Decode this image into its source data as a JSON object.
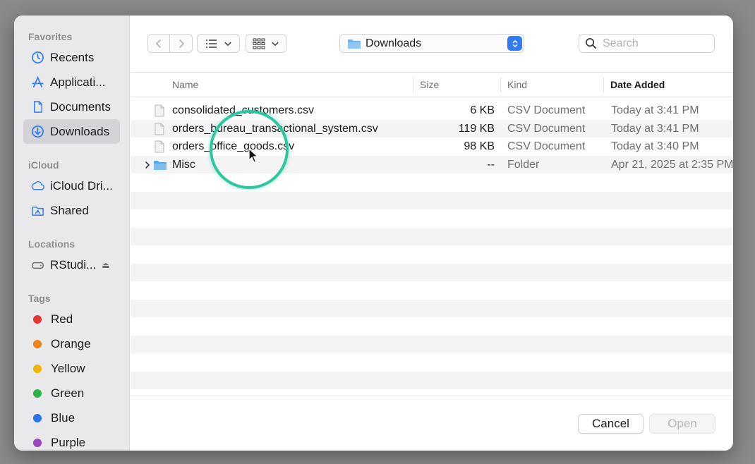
{
  "sidebar": {
    "favorites_label": "Favorites",
    "favorites": [
      {
        "label": "Recents",
        "icon": "clock-icon"
      },
      {
        "label": "Applicati...",
        "icon": "applications-icon"
      },
      {
        "label": "Documents",
        "icon": "document-icon"
      },
      {
        "label": "Downloads",
        "icon": "download-icon"
      }
    ],
    "icloud_label": "iCloud",
    "icloud": [
      {
        "label": "iCloud Dri...",
        "icon": "cloud-icon"
      },
      {
        "label": "Shared",
        "icon": "shared-folder-icon"
      }
    ],
    "locations_label": "Locations",
    "locations": [
      {
        "label": "RStudi...",
        "icon": "drive-icon"
      }
    ],
    "tags_label": "Tags",
    "tags": [
      {
        "label": "Red",
        "color": "#e8342e"
      },
      {
        "label": "Orange",
        "color": "#f08318"
      },
      {
        "label": "Yellow",
        "color": "#efb500"
      },
      {
        "label": "Green",
        "color": "#29b34a"
      },
      {
        "label": "Blue",
        "color": "#2a73e8"
      },
      {
        "label": "Purple",
        "color": "#9b45c2"
      }
    ]
  },
  "toolbar": {
    "location": "Downloads",
    "search_placeholder": "Search"
  },
  "columns": {
    "name": "Name",
    "size": "Size",
    "kind": "Kind",
    "date": "Date Added"
  },
  "files": [
    {
      "name": "consolidated_customers.csv",
      "size": "6 KB",
      "kind": "CSV Document",
      "date": "Today at 3:41 PM",
      "type": "file"
    },
    {
      "name": "orders_bureau_transactional_system.csv",
      "size": "119 KB",
      "kind": "CSV Document",
      "date": "Today at 3:41 PM",
      "type": "file"
    },
    {
      "name": "orders_office_goods.csv",
      "size": "98 KB",
      "kind": "CSV Document",
      "date": "Today at 3:40 PM",
      "type": "file"
    },
    {
      "name": "Misc",
      "size": "--",
      "kind": "Folder",
      "date": "Apr 21, 2025 at 2:35 PM",
      "type": "folder"
    }
  ],
  "footer": {
    "cancel": "Cancel",
    "open": "Open"
  },
  "colors": {
    "accent": "#2f7cf6",
    "click_ring": "#2cc7a0"
  }
}
